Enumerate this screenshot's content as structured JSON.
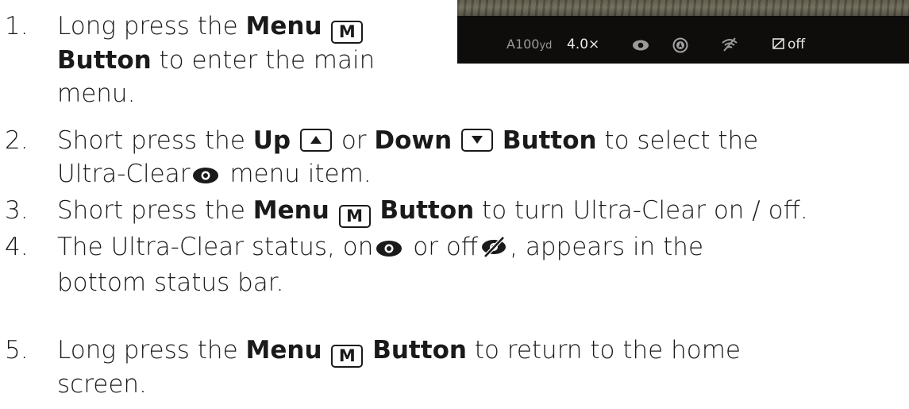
{
  "device": {
    "range": "A100",
    "range_unit": "yd",
    "zoom": "4.0×",
    "icons": [
      "eye-icon",
      "compass-icon",
      "wifi-off-icon",
      "recording-icon"
    ],
    "record_status": "off"
  },
  "steps": [
    {
      "number": "1.",
      "a": "Long press the ",
      "menu": "Menu",
      "key": "M",
      "button": "Button",
      "b": " to enter the main",
      "c": "menu."
    },
    {
      "number": "2.",
      "a": "Short press the ",
      "up": "Up",
      "or": " or ",
      "down": "Down",
      "button": "Button",
      "b": " to select the",
      "c": "Ultra-Clear",
      "d": " menu item."
    },
    {
      "number": "3.",
      "a": "Short press the ",
      "menu": "Menu",
      "key": "M",
      "button": "Button",
      "b": " to turn Ultra-Clear on / off."
    },
    {
      "number": "4.",
      "a": "The Ultra-Clear status, on",
      "b": " or off",
      "c": ", appears in the",
      "d": "bottom status bar."
    },
    {
      "number": "5.",
      "a": "Long press the ",
      "menu": "Menu",
      "key": "M",
      "button": "Button",
      "b": " to return to the home",
      "c": "screen."
    }
  ]
}
